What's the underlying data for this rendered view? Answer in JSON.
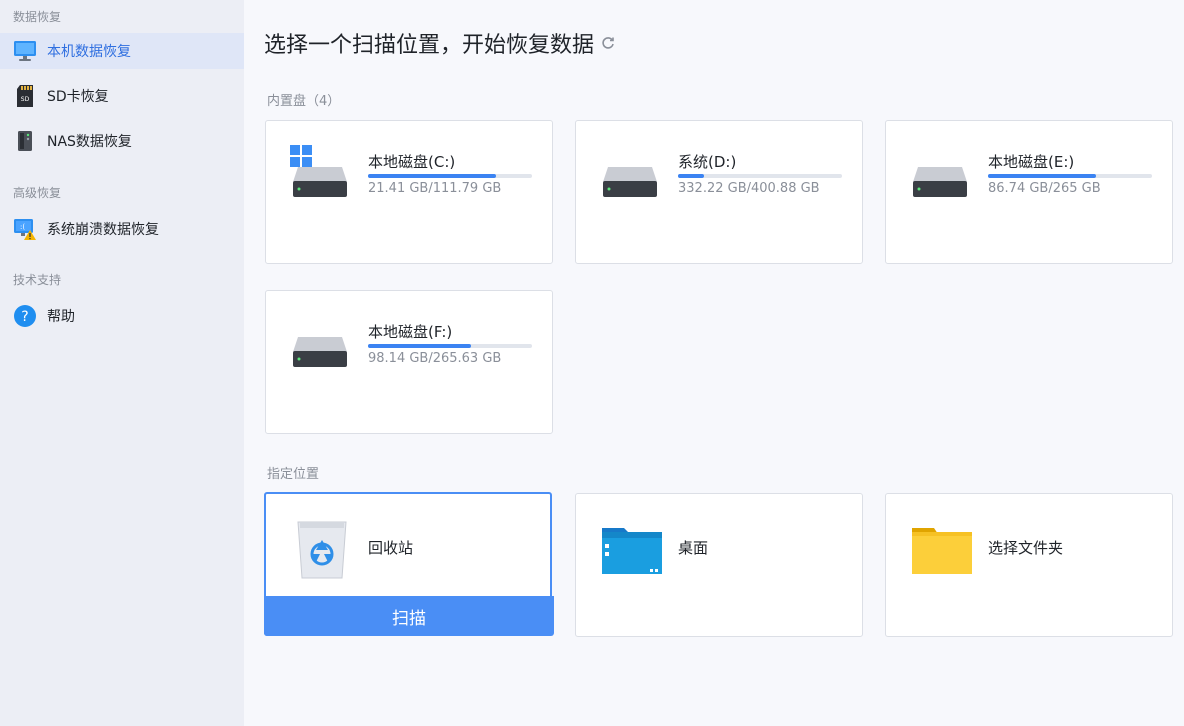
{
  "sidebar": {
    "sections": [
      {
        "title": "数据恢复"
      },
      {
        "title": "高级恢复"
      },
      {
        "title": "技术支持"
      }
    ],
    "items": [
      {
        "label": "本机数据恢复",
        "icon": "monitor-icon",
        "active": true
      },
      {
        "label": "SD卡恢复",
        "icon": "sd-card-icon"
      },
      {
        "label": "NAS数据恢复",
        "icon": "nas-icon"
      },
      {
        "label": "系统崩溃数据恢复",
        "icon": "crash-monitor-icon"
      },
      {
        "label": "帮助",
        "icon": "help-icon"
      }
    ]
  },
  "main": {
    "title": "选择一个扫描位置，开始恢复数据",
    "refresh_icon": "refresh-icon",
    "drives_title": "内置盘（4）",
    "drives": [
      {
        "name": "本地磁盘(C:)",
        "size": "21.41 GB/111.79 GB",
        "used_fraction": 0.78,
        "system": true
      },
      {
        "name": "系统(D:)",
        "size": "332.22 GB/400.88 GB",
        "used_fraction": 0.16
      },
      {
        "name": "本地磁盘(E:)",
        "size": "86.74 GB/265 GB",
        "used_fraction": 0.66
      },
      {
        "name": "本地磁盘(F:)",
        "size": "98.14 GB/265.63 GB",
        "used_fraction": 0.63
      }
    ],
    "locations_title": "指定位置",
    "locations": [
      {
        "name": "回收站",
        "icon": "recycle-bin-icon",
        "selected": true
      },
      {
        "name": "桌面",
        "icon": "desktop-folder-icon"
      },
      {
        "name": "选择文件夹",
        "icon": "folder-icon"
      }
    ],
    "scan_label": "扫描"
  },
  "colors": {
    "accent": "#4a8ef5",
    "progress": "#3b83f2",
    "sidebar_bg": "#eceef5",
    "active_item_bg": "#dfe6f7"
  }
}
